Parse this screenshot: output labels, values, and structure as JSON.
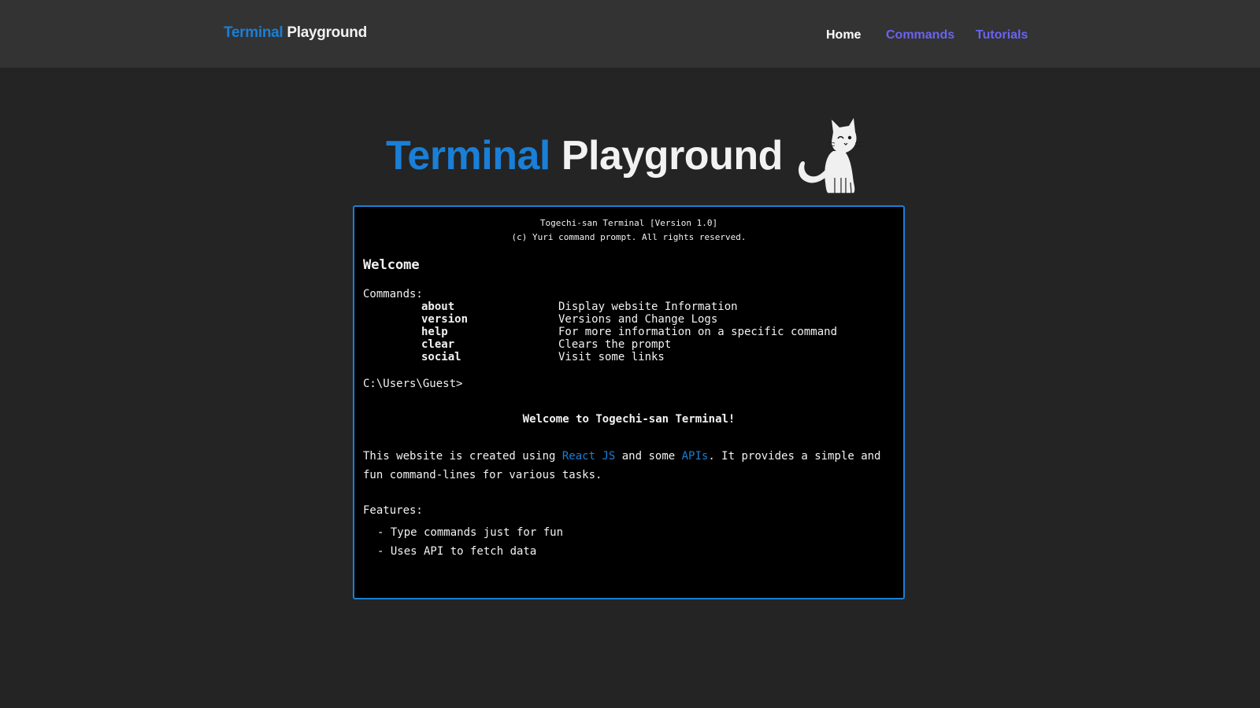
{
  "navbar": {
    "brand_part1": "Terminal",
    "brand_part2": "Playground",
    "links": [
      {
        "label": "Home",
        "active": true
      },
      {
        "label": "Commands",
        "active": false
      },
      {
        "label": "Tutorials",
        "active": false
      }
    ]
  },
  "hero": {
    "title_part1": "Terminal",
    "title_part2": "Playground",
    "logo_icon": "cat-icon"
  },
  "terminal": {
    "header_line1": "Togechi-san Terminal [Version 1.0]",
    "header_line2": "(c) Yuri command prompt. All rights reserved.",
    "welcome_heading": "Welcome",
    "commands_label": "Commands:",
    "commands": [
      {
        "name": "about",
        "desc": "Display website Information"
      },
      {
        "name": "version",
        "desc": "Versions and Change Logs"
      },
      {
        "name": "help",
        "desc": "For more information on a specific command"
      },
      {
        "name": "clear",
        "desc": "Clears the prompt"
      },
      {
        "name": "social",
        "desc": "Visit some links"
      }
    ],
    "prompt": "C:\\Users\\Guest>",
    "welcome_banner": "Welcome to Togechi-san Terminal!",
    "description": {
      "part1": "This website is created using ",
      "link1": "React JS",
      "part2": " and some ",
      "link2": "APIs",
      "part3": ". It provides a simple and fun command-lines for various tasks."
    },
    "features_label": "Features:",
    "features": [
      "- Type commands just for fun",
      "- Uses API to fetch data"
    ]
  },
  "colors": {
    "accent_blue": "#1a7fd6",
    "nav_link_purple": "#6a63f2",
    "navbar_bg": "#333333",
    "page_bg": "#242424",
    "terminal_bg": "#000000"
  }
}
